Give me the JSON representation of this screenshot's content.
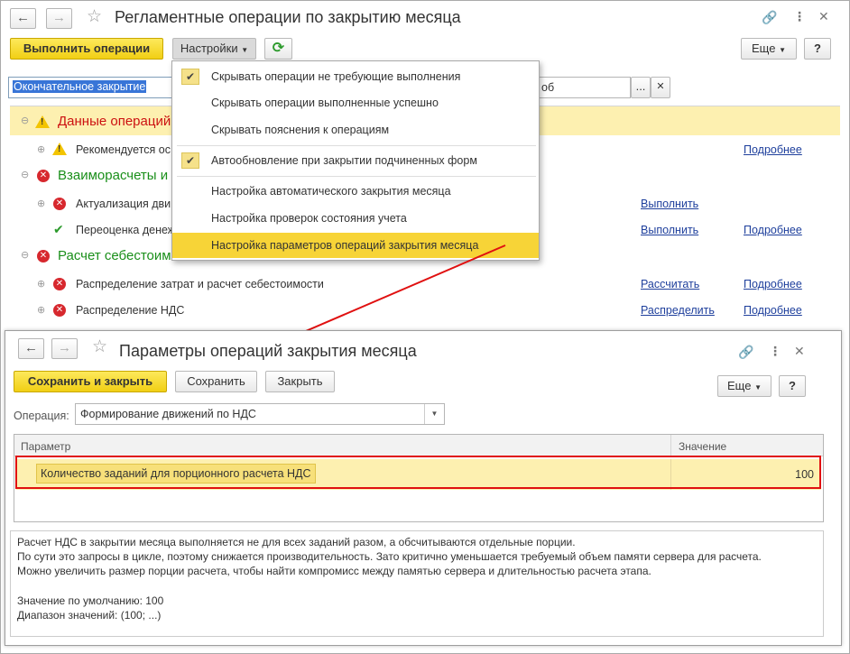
{
  "main": {
    "title": "Регламентные операции по закрытию месяца",
    "back_icon": "arrow-left-icon",
    "forward_icon": "arrow-right-icon",
    "toolbar": {
      "run_label": "Выполнить операции",
      "settings_label": "Настройки",
      "more_label": "Еще",
      "help_label": "?"
    },
    "filter_value": "Окончательное закрытие",
    "org_value_fragment": "об",
    "groups": [
      {
        "label": "Данные операций",
        "color": "#cc1111"
      },
      {
        "label": "Взаиморасчеты и",
        "color": "#1a8f1a"
      },
      {
        "label": "Расчет себестоимости",
        "color": "#1a8f1a"
      }
    ],
    "rows": [
      {
        "label": "Рекомендуется ос",
        "action": "",
        "details": "Подробнее"
      },
      {
        "label": "Актуализация дви",
        "action": "Выполнить",
        "details": ""
      },
      {
        "label": "Переоценка денеж",
        "action": "Выполнить",
        "details": "Подробнее"
      },
      {
        "label": "Распределение затрат и расчет себестоимости",
        "action": "Рассчитать",
        "details": "Подробнее"
      },
      {
        "label": "Распределение НДС",
        "action": "Распределить",
        "details": "Подробнее"
      }
    ]
  },
  "menu": {
    "items": [
      {
        "label": "Скрывать операции не требующие выполнения",
        "checked": true
      },
      {
        "label": "Скрывать операции выполненные успешно",
        "checked": false
      },
      {
        "label": "Скрывать пояснения к операциям",
        "checked": false
      },
      {
        "label": "Автообновление при закрытии подчиненных форм",
        "checked": true
      },
      {
        "label": "Настройка автоматического закрытия месяца",
        "checked": false
      },
      {
        "label": "Настройка проверок состояния учета",
        "checked": false
      },
      {
        "label": "Настройка параметров операций закрытия месяца",
        "checked": false,
        "highlighted": true
      }
    ]
  },
  "dialog": {
    "title": "Параметры операций закрытия месяца",
    "save_close_label": "Сохранить и закрыть",
    "save_label": "Сохранить",
    "close_label": "Закрыть",
    "more_label": "Еще",
    "help_label": "?",
    "operation_label": "Операция:",
    "operation_value": "Формирование движений по НДС",
    "grid": {
      "col_param": "Параметр",
      "col_value": "Значение",
      "rows": [
        {
          "param": "Количество заданий для порционного расчета НДС",
          "value": "100"
        }
      ]
    },
    "description": {
      "line1": "Расчет НДС в закрытии месяца выполняется не для всех заданий разом, а обсчитываются отдельные порции.",
      "line2": "По сути это запросы в цикле, поэтому снижается производительность. Зато критично уменьшается требуемый объем памяти сервера для расчета.",
      "line3": "Можно увеличить размер порции расчета, чтобы найти компромисс между памятью сервера и длительностью расчета этапа.",
      "line4": "Значение по умолчанию: 100",
      "line5": "Диапазон значений: (100; ...)"
    }
  },
  "colors": {
    "accent_yellow": "#f1cf14",
    "highlight_row": "#fdf0b0",
    "annotation_red": "#e01010",
    "link_blue": "#1e3f9c"
  }
}
